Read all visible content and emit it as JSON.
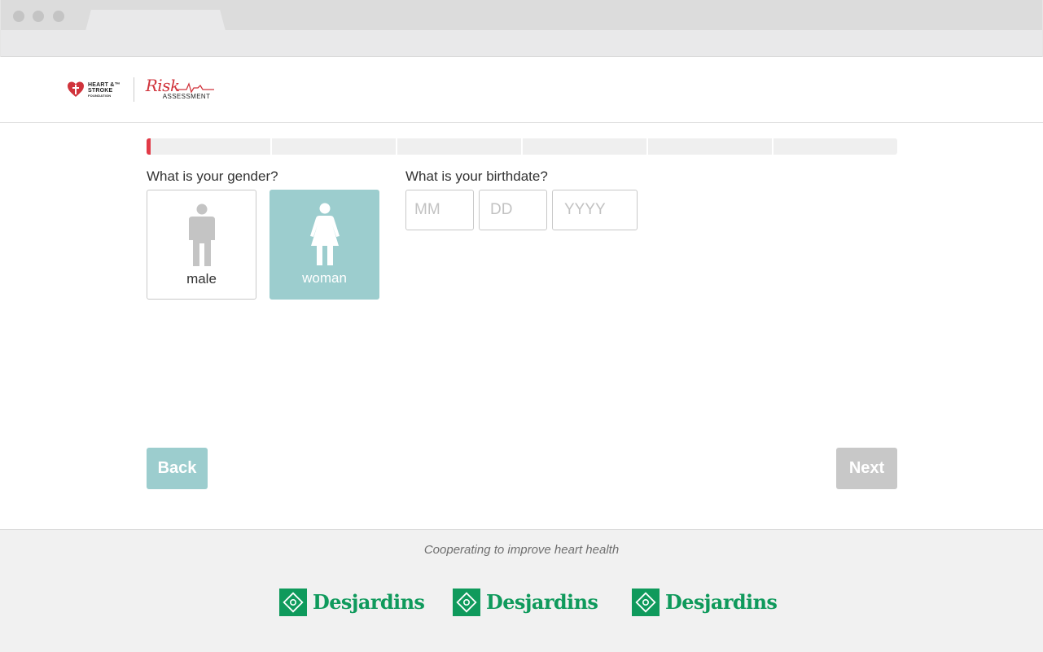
{
  "header": {
    "hsf_logo_lines": [
      "HEART &™",
      "STROKE",
      "FOUNDATION"
    ],
    "risk_logo_word": "Risk",
    "risk_logo_sub": "ASSESSMENT"
  },
  "progress": {
    "steps": 6,
    "current_step": 1,
    "current_step_fill": 0.03,
    "accent_color": "#e23a47"
  },
  "gender": {
    "question": "What is your gender?",
    "options": [
      {
        "label": "male",
        "icon": "man-icon",
        "selected": false
      },
      {
        "label": "woman",
        "icon": "woman-icon",
        "selected": true
      }
    ],
    "selected_color": "#9ccdce"
  },
  "birthdate": {
    "question": "What is your birthdate?",
    "month_placeholder": "MM",
    "day_placeholder": "DD",
    "year_placeholder": "YYYY"
  },
  "nav": {
    "back_label": "Back",
    "next_label": "Next",
    "next_disabled": true
  },
  "footer": {
    "tagline": "Cooperating to improve heart health",
    "sponsors": [
      {
        "name": "Desjardins",
        "icon": "desjardins-logo-icon"
      },
      {
        "name": "Desjardins",
        "icon": "desjardins-logo-icon"
      },
      {
        "name": "Desjardins",
        "icon": "desjardins-logo-icon"
      }
    ],
    "brand_color": "#0f9a5c"
  }
}
